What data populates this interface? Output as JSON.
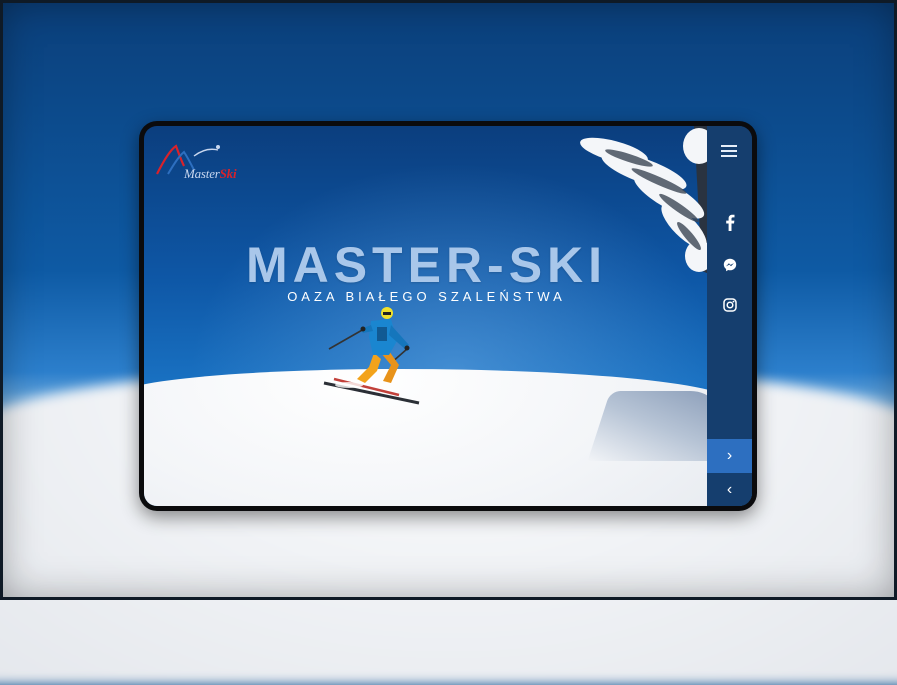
{
  "brand": {
    "logo_text_main": "Master",
    "logo_text_accent": "Ski"
  },
  "hero": {
    "title": "MASTER-SKI",
    "subtitle": "OAZA BIAŁEGO SZALEŃSTWA"
  },
  "sidebar": {
    "menu_icon": "hamburger-icon",
    "social": [
      {
        "name": "facebook",
        "icon": "facebook-icon"
      },
      {
        "name": "messenger",
        "icon": "messenger-icon"
      },
      {
        "name": "instagram",
        "icon": "instagram-icon"
      }
    ],
    "next_label": "›",
    "prev_label": "‹"
  },
  "colors": {
    "sidebar_bg": "#153e6e",
    "next_bg": "#2d6fc0",
    "title_color": "#a9c7ea",
    "logo_red": "#d8222b"
  }
}
